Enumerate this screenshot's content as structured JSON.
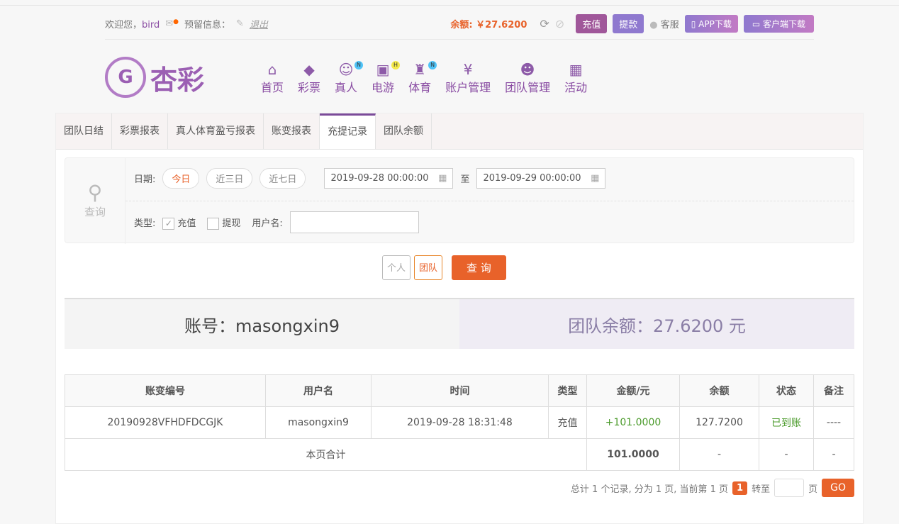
{
  "top": {
    "welcome": "欢迎您，",
    "user": "bird",
    "reserved": "预留信息：",
    "logout": "退出",
    "balance_label": "余额:",
    "balance": "￥27.6200",
    "deposit": "充值",
    "withdraw": "提款",
    "service": "客服",
    "app": "APP下载",
    "client": "客户端下载"
  },
  "logo": {
    "text": "杏彩"
  },
  "nav": [
    {
      "label": "首页",
      "icon": "⌂"
    },
    {
      "label": "彩票",
      "icon": "◆"
    },
    {
      "label": "真人",
      "icon": "☺",
      "badge": "N"
    },
    {
      "label": "电游",
      "icon": "▣",
      "badge": "H"
    },
    {
      "label": "体育",
      "icon": "♜",
      "badge": "N"
    },
    {
      "label": "账户管理",
      "icon": "¥"
    },
    {
      "label": "团队管理",
      "icon": "☻"
    },
    {
      "label": "活动",
      "icon": "▦"
    }
  ],
  "tabs": [
    "团队日结",
    "彩票报表",
    "真人体育盈亏报表",
    "账变报表",
    "充提记录",
    "团队余额"
  ],
  "filter": {
    "query": "查询",
    "date_label": "日期:",
    "today": "今日",
    "three": "近三日",
    "seven": "近七日",
    "start": "2019-09-28 00:00:00",
    "to": "至",
    "end": "2019-09-29 00:00:00",
    "type_label": "类型:",
    "deposit": "充值",
    "withdraw": "提现",
    "username_label": "用户名:"
  },
  "actions": {
    "personal": "个人",
    "team": "团队",
    "search": "查 询"
  },
  "summary": {
    "account": "账号：masongxin9",
    "team_balance": "团队余额：27.6200 元"
  },
  "table": {
    "headers": [
      "账变编号",
      "用户名",
      "时间",
      "类型",
      "金额/元",
      "余额",
      "状态",
      "备注"
    ],
    "rows": [
      [
        "20190928VFHDFDCGJK",
        "masongxin9",
        "2019-09-28 18:31:48",
        "充值",
        "+101.0000",
        "127.7200",
        "已到账",
        "----"
      ]
    ],
    "total": {
      "label": "本页合计",
      "amount": "101.0000",
      "balance": "-",
      "status": "-",
      "note": "-"
    }
  },
  "pager": {
    "text": "总计 1 个记录, 分为 1 页, 当前第 1 页",
    "current": "1",
    "goto": "转至",
    "page": "页",
    "go": "GO"
  }
}
